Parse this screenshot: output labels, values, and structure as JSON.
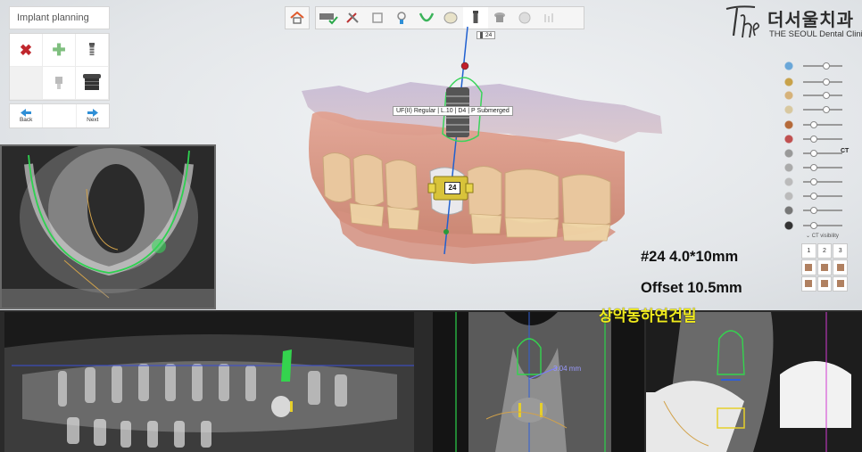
{
  "left_panel": {
    "title": "Implant planning",
    "tools": [
      "delete-icon",
      "add-implant-icon",
      "implant-icon",
      "empty",
      "abutment-icon",
      "sleeve-icon"
    ],
    "nav": {
      "back_label": "Back",
      "next_label": "Next"
    }
  },
  "toolbar": {
    "home": "home-icon",
    "steps": [
      "model-check-icon",
      "tools-icon",
      "case-icon",
      "scan-icon",
      "arch-icon",
      "tooth-icon",
      "implant-icon",
      "sleeve-icon",
      "guide-icon",
      "export-icon"
    ]
  },
  "logo": {
    "korean": "더서울치과",
    "english": "THE SEOUL Dental Clinic"
  },
  "viewport": {
    "implant_label": "UF(II) Regular | L.10 | D4 | P Submerged",
    "tooth_tag": "24",
    "tooth_badge": "24"
  },
  "right_panel": {
    "slider_levels": [
      0.55,
      0.55,
      0.55,
      0.55,
      0.2,
      0.2,
      0.2,
      0.2,
      0.2,
      0.2,
      0.2,
      0.2
    ],
    "ct_label": "CT",
    "ct_visibility_label": "CT visibility",
    "view_numbers": [
      "1",
      "2",
      "3"
    ]
  },
  "annotations": {
    "spec": "#24 4.0*10mm",
    "offset": "Offset 10.5mm",
    "korean_note": "상악동하연건밀",
    "measurement": "3.04 mm"
  },
  "colors": {
    "accent_blue": "#2f8fd6",
    "delete_red": "#c0272d",
    "note_yellow": "#f1ec1e",
    "arrow_red": "#e0262a",
    "guide_green": "#3ad45a"
  }
}
